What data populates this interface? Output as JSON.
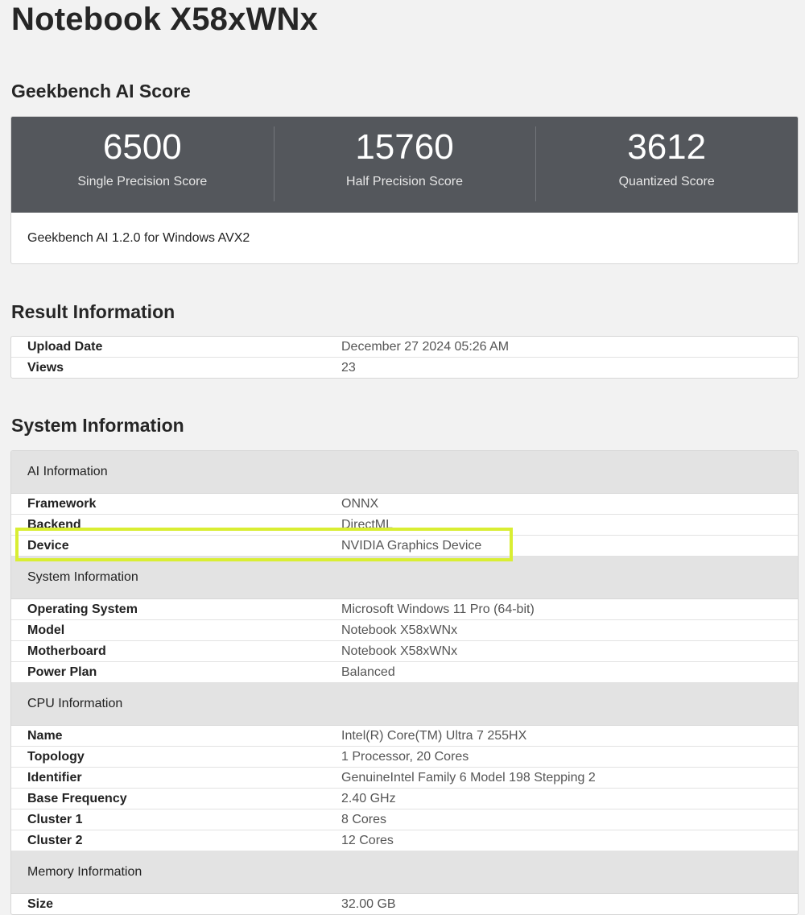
{
  "title": "Notebook X58xWNx",
  "score_section": {
    "title": "Geekbench AI Score",
    "scores": [
      {
        "value": "6500",
        "label": "Single Precision Score"
      },
      {
        "value": "15760",
        "label": "Half Precision Score"
      },
      {
        "value": "3612",
        "label": "Quantized Score"
      }
    ],
    "version": "Geekbench AI 1.2.0 for Windows AVX2"
  },
  "result_section": {
    "title": "Result Information",
    "rows": [
      {
        "k": "Upload Date",
        "v": "December 27 2024 05:26 AM"
      },
      {
        "k": "Views",
        "v": "23"
      }
    ]
  },
  "system_section": {
    "title": "System Information",
    "groups": [
      {
        "name": "AI Information",
        "rows": [
          {
            "k": "Framework",
            "v": "ONNX"
          },
          {
            "k": "Backend",
            "v": "DirectML"
          },
          {
            "k": "Device",
            "v": "NVIDIA Graphics Device"
          }
        ]
      },
      {
        "name": "System Information",
        "rows": [
          {
            "k": "Operating System",
            "v": "Microsoft Windows 11 Pro (64-bit)"
          },
          {
            "k": "Model",
            "v": "Notebook X58xWNx"
          },
          {
            "k": "Motherboard",
            "v": "Notebook X58xWNx"
          },
          {
            "k": "Power Plan",
            "v": "Balanced"
          }
        ]
      },
      {
        "name": "CPU Information",
        "rows": [
          {
            "k": "Name",
            "v": "Intel(R) Core(TM) Ultra 7 255HX"
          },
          {
            "k": "Topology",
            "v": "1 Processor, 20 Cores"
          },
          {
            "k": "Identifier",
            "v": "GenuineIntel Family 6 Model 198 Stepping 2"
          },
          {
            "k": "Base Frequency",
            "v": "2.40 GHz"
          },
          {
            "k": "Cluster 1",
            "v": "8 Cores"
          },
          {
            "k": "Cluster 2",
            "v": "12 Cores"
          }
        ]
      },
      {
        "name": "Memory Information",
        "rows": [
          {
            "k": "Size",
            "v": "32.00 GB"
          }
        ]
      }
    ]
  },
  "colors": {
    "score_band": "#54575c",
    "highlight": "#d9ee33",
    "group_header": "#e3e3e3"
  }
}
